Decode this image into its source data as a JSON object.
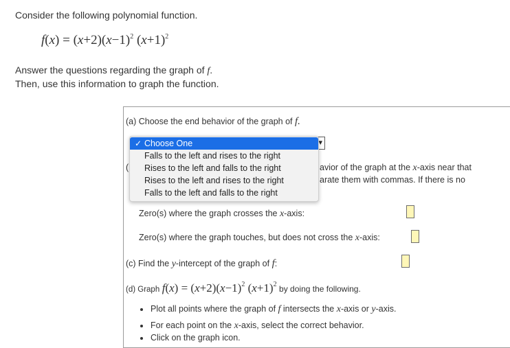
{
  "intro": "Consider the following polynomial function.",
  "function": {
    "lhs": "f",
    "arg": "x",
    "factor1": "(x+2)",
    "factor2": "(x−1)",
    "factor2_exp": "2",
    "factor3": "(x+1)",
    "factor3_exp": "2"
  },
  "instructions": [
    "Answer the questions regarding the graph of f.",
    "Then, use this information to graph the function."
  ],
  "part_a": {
    "label": "(a) Choose the end behavior of the graph of",
    "fn": "f.",
    "select_value": "Choose One",
    "options": [
      "Choose One",
      "Falls to the left and rises to the right",
      "Rises to the left and falls to the right",
      "Rises to the left and rises to the right",
      "Falls to the left and falls to the right"
    ]
  },
  "part_b": {
    "label_prefix": "(",
    "line1_tail": "avior of the graph at the x-axis near that",
    "line2_tail": "arate them with commas. If there is no",
    "crosses_label": "Zero(s) where the graph crosses the x-axis:",
    "touches_label": "Zero(s) where the graph touches, but does not cross the x-axis:",
    "crosses_value": "",
    "touches_value": ""
  },
  "part_c": {
    "label": "(c) Find the y-intercept of the graph of f:",
    "value": ""
  },
  "part_d": {
    "label_prefix": "(d) Graph",
    "label_suffix": "by doing the following.",
    "bullets": [
      "Plot all points where the graph of f intersects the x-axis or y-axis.",
      "For each point on the x-axis, select the correct behavior.",
      "Click on the graph icon."
    ]
  },
  "colors": {
    "accent": "#1b6ee6",
    "answer_box": "#fff7b8",
    "text": "#333333"
  }
}
